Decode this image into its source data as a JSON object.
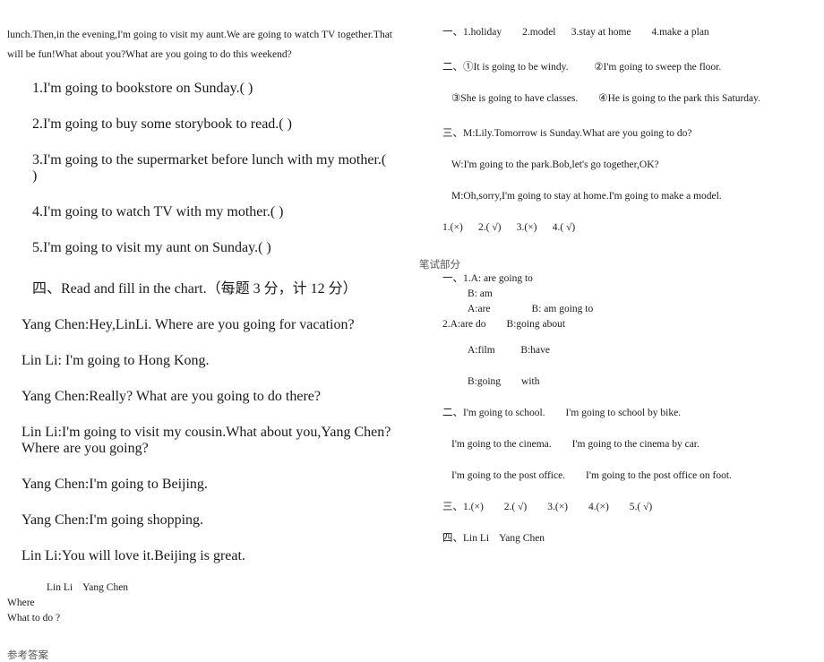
{
  "document": {
    "left_column": {
      "passage": {
        "text": "lunch.Then,in the evening,I'm going to visit my aunt.We are going to watch TV together.That will be fun!What about you?What are you going to do this weekend?"
      },
      "true_false_items": [
        "1.I'm going to bookstore on Sunday.(        )",
        "2.I'm going to buy some storybook to read.(        )",
        "3.I'm going to the supermarket before lunch with my mother.(        )",
        "4.I'm going to watch TV with my mother.(        )",
        "5.I'm going to visit my aunt on Sunday.(        )"
      ],
      "section_four": {
        "heading": "四、Read and fill in the chart.（每题 3 分，计 12 分）",
        "dialogue": [
          "Yang Chen:Hey,LinLi. Where are you going for vacation?",
          "Lin Li: I'm going to Hong Kong.",
          "Yang Chen:Really? What are you going to do there?",
          "Lin Li:I'm going to visit my cousin.What about you,Yang Chen?Where are you going?",
          "Yang Chen:I'm going to Beijing.",
          "Yang Chen:I'm going shopping.",
          "Lin Li:You will love it.Beijing is great."
        ],
        "chart_header": "Lin Li    Yang Chen",
        "chart_rows": [
          "Where",
          "What to do ?"
        ]
      },
      "answer_key_title": "参考答案"
    },
    "right_column": {
      "listening_answers": [
        {
          "label": "一、",
          "lines": [
            "1.holiday        2.model      3.stay at home        4.make a plan"
          ]
        },
        {
          "label": "二、",
          "lines": [
            "①It is going to be windy.          ②I'm going to sweep the floor.",
            "③She is going to have classes.        ④He is going to the park this Saturday."
          ]
        },
        {
          "label": "三、",
          "lines": [
            "M:Lily.Tomorrow is Sunday.What are you going to do?",
            "W:I'm going to the park.Bob,let's go together,OK?",
            "M:Oh,sorry,I'm going to stay at home.I'm going to make a model."
          ]
        }
      ],
      "listening_three_results": "1.(×)      2.( √)      3.(×)      4.( √)",
      "written_section": {
        "title": "笔试部分",
        "one": {
          "label": "一、",
          "lines": [
            "1.A: are going to",
            "B: am",
            "A:are                B: am going to",
            "2.A:are do        B:going about",
            "A:film          B:have",
            "B:going        with"
          ]
        },
        "two": {
          "label": "二、",
          "lines": [
            "I'm going to school.        I'm going to school by bike.",
            "I'm going to the cinema.        I'm going to the cinema by car.",
            "I'm going to the post office.        I'm going to the post office on foot."
          ]
        },
        "three": {
          "label": "三、",
          "text": "1.(×)        2.( √)        3.(×)        4.(×)        5.( √)"
        },
        "four": {
          "label": "四、",
          "text": "Lin Li    Yang Chen"
        }
      }
    }
  }
}
